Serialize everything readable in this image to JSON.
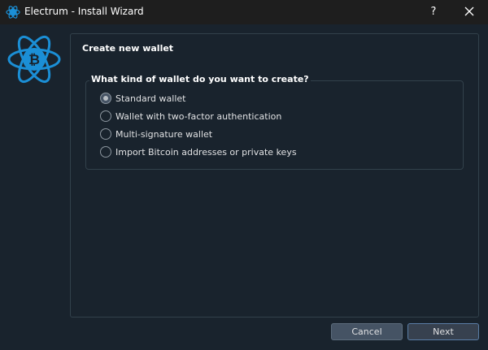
{
  "window": {
    "title": "Electrum  -  Install Wizard",
    "help_glyph": "?",
    "close_icon": "close-icon",
    "app_icon": "electrum-app-icon"
  },
  "logo": {
    "icon": "electrum-bitcoin-logo",
    "color": "#1b8fd6"
  },
  "page": {
    "heading": "Create new wallet",
    "group_title": "What kind of wallet do you want to create?",
    "options": [
      {
        "label": "Standard wallet",
        "checked": true
      },
      {
        "label": "Wallet with two-factor authentication",
        "checked": false
      },
      {
        "label": "Multi-signature wallet",
        "checked": false
      },
      {
        "label": "Import Bitcoin addresses or private keys",
        "checked": false
      }
    ]
  },
  "buttons": {
    "cancel": "Cancel",
    "next": "Next"
  },
  "colors": {
    "background": "#19232d",
    "titlebar": "#1e1e1e",
    "accent": "#1b8fd6",
    "border": "#32414b"
  }
}
